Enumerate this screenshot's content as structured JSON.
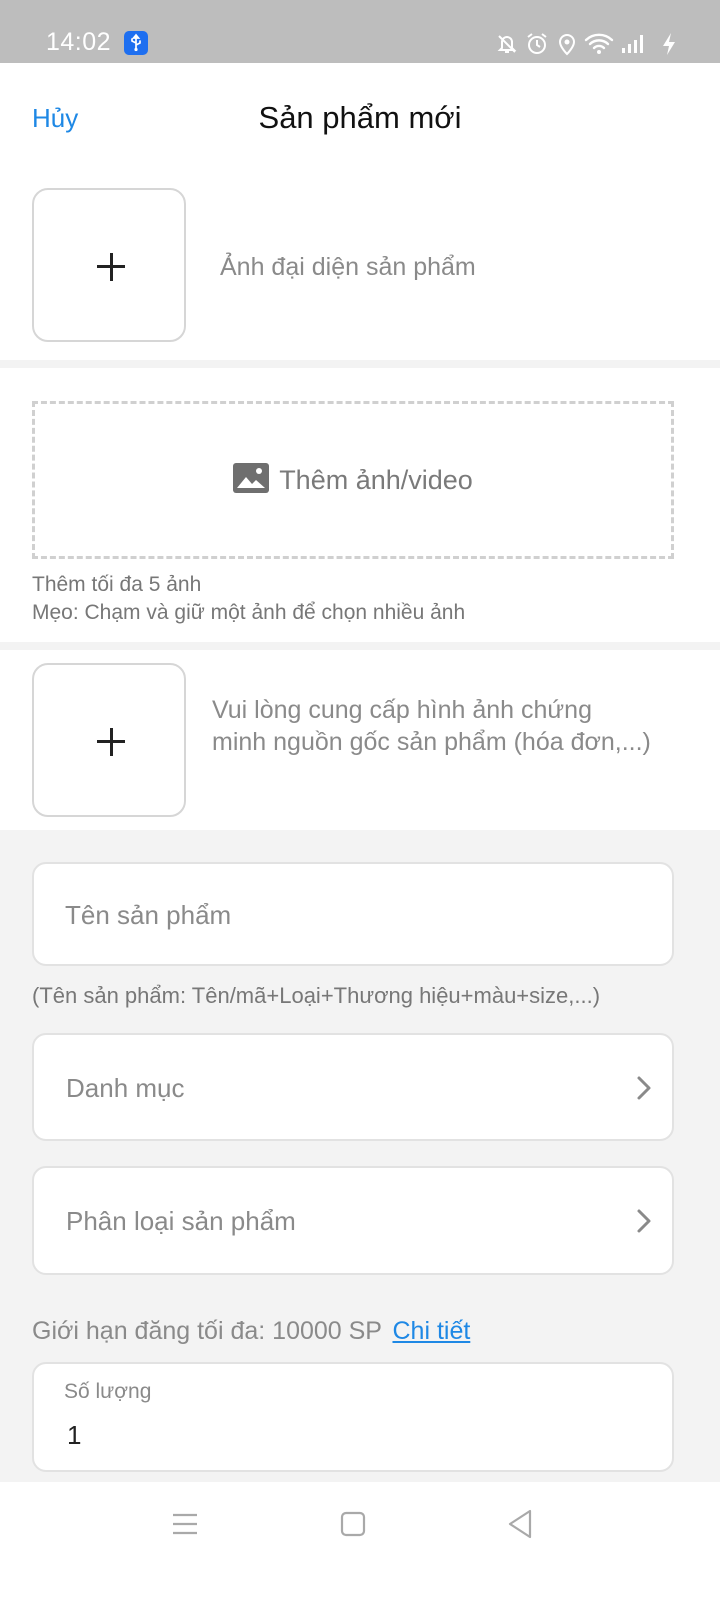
{
  "status_bar": {
    "time": "14:02",
    "icons": [
      "usb-icon",
      "bell-off-icon",
      "alarm-icon",
      "location-icon",
      "wifi-icon",
      "signal-icon",
      "charging-icon"
    ]
  },
  "header": {
    "cancel_label": "Hủy",
    "title": "Sản phẩm mới"
  },
  "cover_image": {
    "label": "Ảnh đại diện sản phẩm"
  },
  "media": {
    "add_label": "Thêm ảnh/video",
    "limit_note": "Thêm tối đa 5 ảnh",
    "tip_note": "Mẹo: Chạm và giữ một ảnh để chọn nhiều ảnh"
  },
  "proof": {
    "label": "Vui lòng cung cấp hình ảnh chứng minh nguồn gốc sản phẩm (hóa đơn,...)"
  },
  "form": {
    "name_placeholder": "Tên sản phẩm",
    "name_hint": "(Tên sản phẩm: Tên/mã+Loại+Thương hiệu+màu+size,...)",
    "category_label": "Danh mục",
    "classification_label": "Phân loại sản phẩm",
    "limit_text": "Giới hạn đăng tối đa: 10000 SP",
    "limit_link": "Chi tiết",
    "quantity_label": "Số lượng",
    "quantity_value": "1"
  },
  "colors": {
    "accent": "#1e88e5",
    "status_bar": "#bdbdbd",
    "usb_badge": "#1e6ff0"
  },
  "nav_bar": {
    "icons": [
      "menu-icon",
      "home-square-icon",
      "back-triangle-icon"
    ]
  }
}
